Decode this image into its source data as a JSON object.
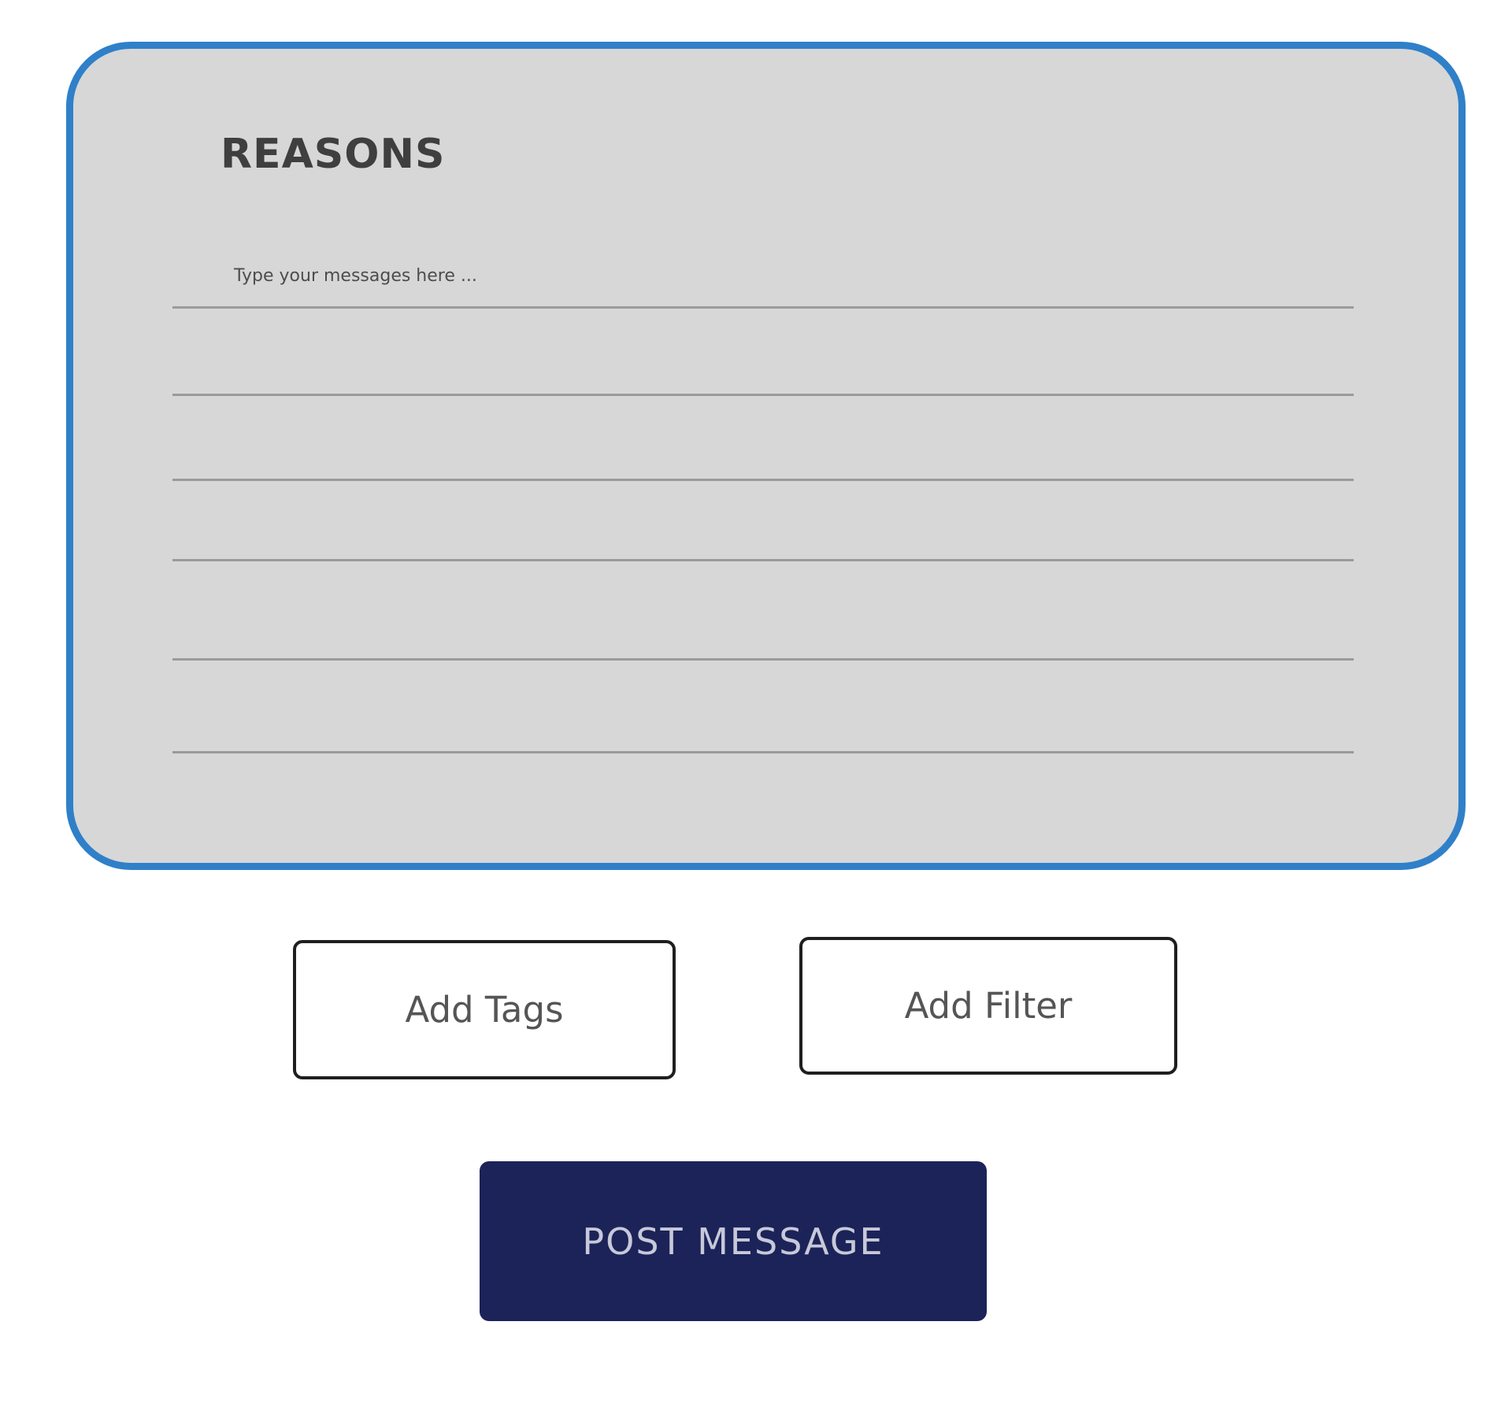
{
  "card": {
    "title": "REASONS",
    "message_placeholder": "Type your messages here ...",
    "message_value": "",
    "border_color": "#2f80c9",
    "background_color": "#d7d7d7"
  },
  "actions": {
    "add_tags_label": "Add Tags",
    "add_filter_label": "Add Filter",
    "post_label": "POST MESSAGE",
    "post_background_color": "#1c2359"
  }
}
